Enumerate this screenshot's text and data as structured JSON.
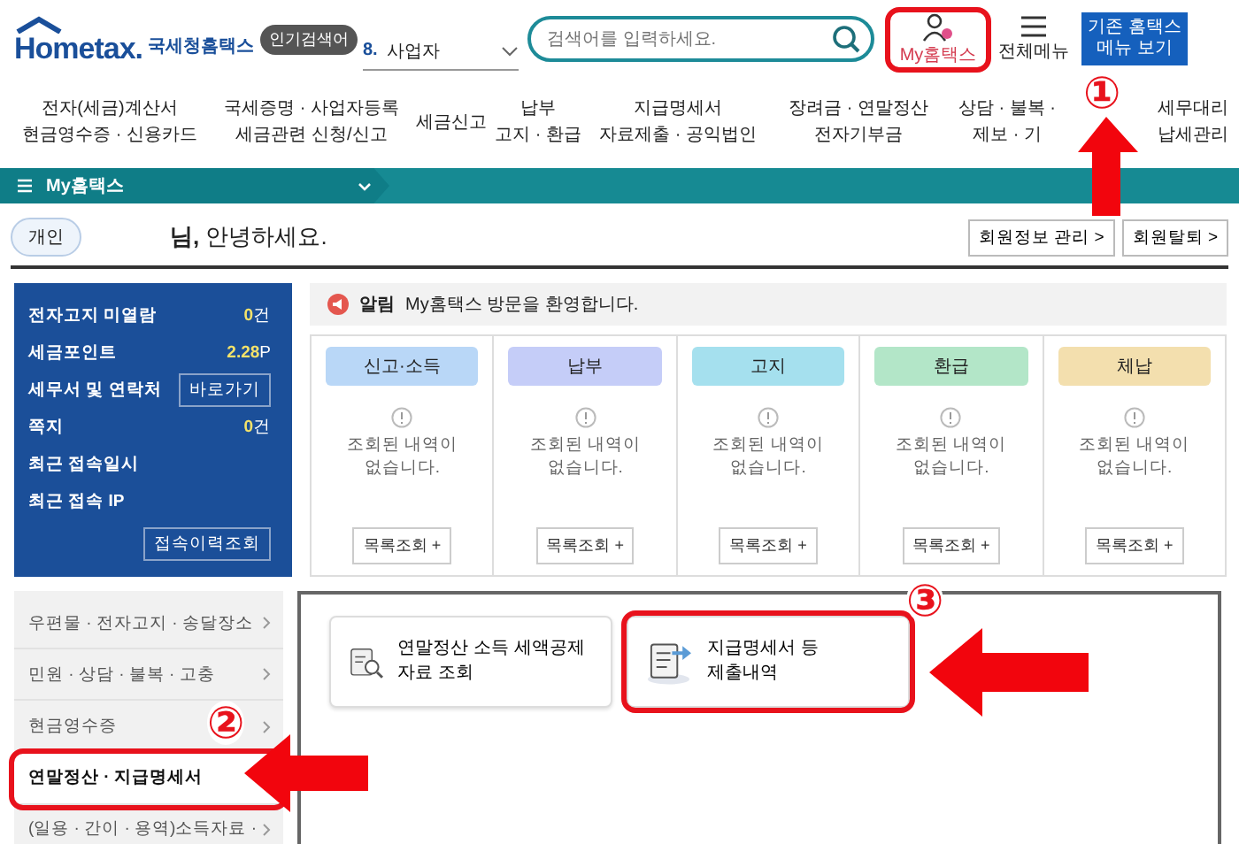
{
  "header": {
    "brand": "Hometax.",
    "subtitle": "국세청홈택스",
    "popular": {
      "badge": "인기검색어",
      "rank": "8.",
      "term": "사업자"
    },
    "search": {
      "placeholder": "검색어를 입력하세요."
    },
    "my_hometax": "My홈택스",
    "all_menu": "전체메뉴",
    "legacy_button": "기존 홈택스 메뉴 보기"
  },
  "nav": [
    {
      "lines": [
        "전자(세금)계산서",
        "현금영수증 · 신용카드"
      ]
    },
    {
      "lines": [
        "국세증명 · 사업자등록",
        "세금관련 신청/신고"
      ]
    },
    {
      "lines": [
        "세금신고"
      ]
    },
    {
      "lines": [
        "납부",
        "고지 · 환급"
      ]
    },
    {
      "lines": [
        "지급명세서",
        "자료제출 · 공익법인"
      ]
    },
    {
      "lines": [
        "장려금 · 연말정산",
        "전자기부금"
      ]
    },
    {
      "lines": [
        "상담 · 불복 ·",
        "제보 · 기"
      ]
    },
    {
      "lines": [
        "세무대리",
        "납세관리"
      ]
    }
  ],
  "breadcrumb": "My홈택스",
  "greeting": {
    "tag": "개인",
    "text": "**님,** 안녕하세요.",
    "buttons": [
      "회원정보 관리 >",
      "회원탈퇴 >"
    ]
  },
  "summary": [
    {
      "kind": "count",
      "label": "전자고지 미열람",
      "value": "0",
      "unit": "건"
    },
    {
      "kind": "count",
      "label": "세금포인트",
      "value": "2.28",
      "unit": "P"
    },
    {
      "kind": "button",
      "label": "세무서 및 연락처",
      "button": "바로가기"
    },
    {
      "kind": "count",
      "label": "쪽지",
      "value": "0",
      "unit": "건"
    },
    {
      "kind": "plain",
      "label": "최근 접속일시"
    },
    {
      "kind": "plain",
      "label": "최근 접속 IP"
    }
  ],
  "history_button": "접속이력조회",
  "notice": {
    "label": "알림",
    "message": "My홈택스 방문을 환영합니다."
  },
  "cards": [
    {
      "title": "신고·소득",
      "color": "#b9d7f7",
      "message": "조회된 내역이 없습니다.",
      "button": "목록조회 +"
    },
    {
      "title": "납부",
      "color": "#c5cdf8",
      "message": "조회된 내역이 없습니다.",
      "button": "목록조회 +"
    },
    {
      "title": "고지",
      "color": "#a5e0ee",
      "message": "조회된 내역이 없습니다.",
      "button": "목록조회 +"
    },
    {
      "title": "환급",
      "color": "#b3e6c8",
      "message": "조회된 내역이 없습니다.",
      "button": "목록조회 +"
    },
    {
      "title": "체납",
      "color": "#f3dfae",
      "message": "조회된 내역이 없습니다.",
      "button": "목록조회 +"
    }
  ],
  "menu": [
    {
      "label": "우편물 · 전자고지 · 송달장소",
      "selected": false
    },
    {
      "label": "민원 · 상담 · 불복 · 고충",
      "selected": false
    },
    {
      "label": "현금영수증",
      "selected": false
    },
    {
      "label": "연말정산 · 지급명세서",
      "selected": true
    },
    {
      "label": "(일용 · 간이 · 용역)소득자료 ·",
      "selected": false
    }
  ],
  "services": [
    {
      "kind": "search-doc",
      "label": "연말정산 소득 세액공제 자료 조회"
    },
    {
      "kind": "send-doc",
      "label": "지급명세서 등 제출내역"
    }
  ],
  "annotations": [
    {
      "number": "①"
    },
    {
      "number": "②"
    },
    {
      "number": "③"
    }
  ]
}
